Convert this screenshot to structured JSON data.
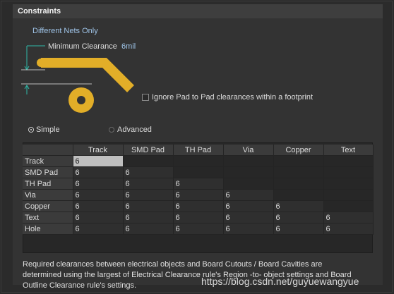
{
  "header": {
    "title": "Constraints"
  },
  "options": {
    "net_scope": "Different Nets Only",
    "min_clearance_label": "Minimum Clearance",
    "min_clearance_value": "6mil",
    "ignore_pad_label": "Ignore Pad to Pad clearances within a footprint",
    "ignore_pad_checked": false,
    "mode_simple": "Simple",
    "mode_advanced": "Advanced",
    "mode_selected": "Simple"
  },
  "colors": {
    "copper": "#e2ae28",
    "accent_blue": "#9fc4e8"
  },
  "grid": {
    "columns": [
      "Track",
      "SMD Pad",
      "TH Pad",
      "Via",
      "Copper",
      "Text"
    ],
    "rows": [
      {
        "label": "Track",
        "values": [
          "6"
        ]
      },
      {
        "label": "SMD Pad",
        "values": [
          "6",
          "6"
        ]
      },
      {
        "label": "TH Pad",
        "values": [
          "6",
          "6",
          "6"
        ]
      },
      {
        "label": "Via",
        "values": [
          "6",
          "6",
          "6",
          "6"
        ]
      },
      {
        "label": "Copper",
        "values": [
          "6",
          "6",
          "6",
          "6",
          "6"
        ]
      },
      {
        "label": "Text",
        "values": [
          "6",
          "6",
          "6",
          "6",
          "6",
          "6"
        ]
      },
      {
        "label": "Hole",
        "values": [
          "6",
          "6",
          "6",
          "6",
          "6",
          "6"
        ]
      }
    ]
  },
  "note": "Required clearances between electrical objects and Board Cutouts / Board Cavities are determined using the largest of Electrical Clearance rule's Region -to- object settings and Board Outline Clearance rule's settings.",
  "watermark": "https://blog.csdn.net/guyuewangyue"
}
